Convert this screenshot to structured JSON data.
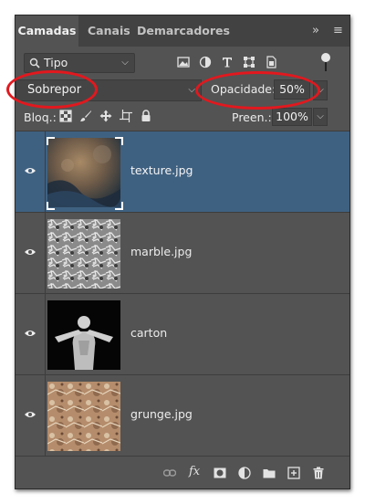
{
  "tabs": [
    {
      "label": "Camadas",
      "active": true
    },
    {
      "label": "Canais",
      "active": false
    },
    {
      "label": "Demarcadores",
      "active": false
    }
  ],
  "panel_icons": [
    "expand-icon",
    "panel-menu-icon"
  ],
  "filter": {
    "kind_label": "Tipo",
    "filter_icons": [
      "pixel-filter-icon",
      "adjustment-filter-icon",
      "type-filter-icon",
      "shape-filter-icon",
      "smart-object-filter-icon"
    ]
  },
  "blend": {
    "mode": "Sobrepor",
    "opacity_label": "Opacidade:",
    "opacity": "50%"
  },
  "locks": {
    "label": "Bloq.:",
    "icons": [
      "lock-transparent-icon",
      "lock-paint-icon",
      "lock-position-icon",
      "lock-artboard-icon",
      "lock-all-icon"
    ],
    "fill_label": "Preen.:",
    "fill": "100%"
  },
  "layers": [
    {
      "name": "texture.jpg",
      "selected": true,
      "visible": true
    },
    {
      "name": "marble.jpg",
      "selected": false,
      "visible": true
    },
    {
      "name": "carton",
      "selected": false,
      "visible": true
    },
    {
      "name": "grunge.jpg",
      "selected": false,
      "visible": true
    }
  ],
  "footer_icons": [
    "link-layers-icon",
    "fx-icon",
    "add-mask-icon",
    "new-adjustment-icon",
    "new-group-icon",
    "new-layer-icon",
    "delete-layer-icon"
  ],
  "colors": {
    "panel_bg": "#535353",
    "tabbar_bg": "#424242",
    "selection": "#3f6181",
    "highlight": "#e2181e"
  }
}
